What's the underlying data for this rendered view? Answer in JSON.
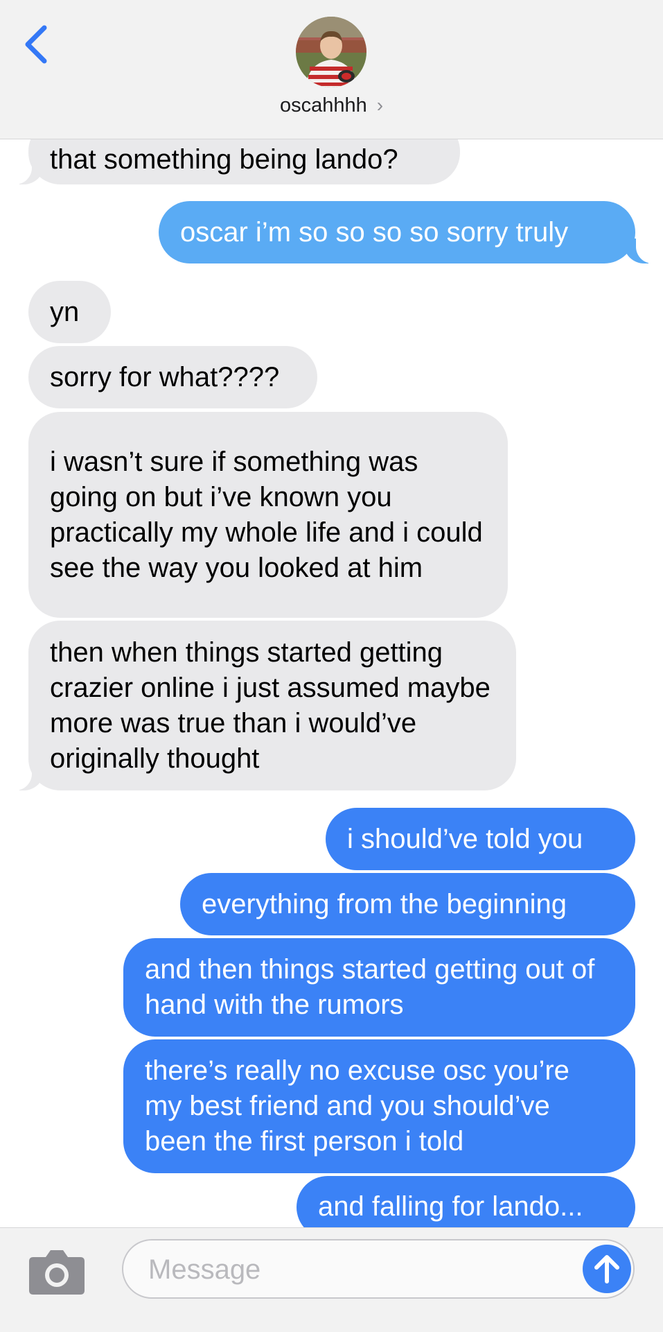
{
  "header": {
    "contact_name": "oscahhhh",
    "chevron": "›",
    "icons": {
      "back": "chevron-left-icon",
      "avatar": "contact-avatar"
    },
    "accent": "#3478f6"
  },
  "messages": [
    {
      "side": "received",
      "text": "that something being lando?"
    },
    {
      "side": "sent",
      "text": "oscar i’m so so so so sorry truly"
    },
    {
      "side": "received",
      "text": "yn"
    },
    {
      "side": "received",
      "text": "sorry for what????"
    },
    {
      "side": "received",
      "text": "i wasn’t sure if something was going on but i’ve known you practically my whole life and i could see the way you looked at him"
    },
    {
      "side": "received",
      "text": "then when things started getting crazier online i just assumed maybe more was true than i would’ve originally thought"
    },
    {
      "side": "sent",
      "text": "i should’ve told you"
    },
    {
      "side": "sent",
      "text": "everything from the beginning"
    },
    {
      "side": "sent",
      "text": "and then things started getting out of hand with the rumors"
    },
    {
      "side": "sent",
      "text": "there’s really no excuse osc you’re my best friend and you should’ve been the first person i told"
    },
    {
      "side": "sent",
      "text": "and falling for lando..."
    }
  ],
  "input": {
    "placeholder": "Message",
    "value": "",
    "icons": {
      "camera": "camera-icon",
      "send": "arrow-up-icon"
    }
  },
  "colors": {
    "received_bubble": "#e9e9eb",
    "sent_bubble": "#3b82f6",
    "sent_bubble_faded": "#5aabf4",
    "header_bg": "#f2f2f2"
  }
}
